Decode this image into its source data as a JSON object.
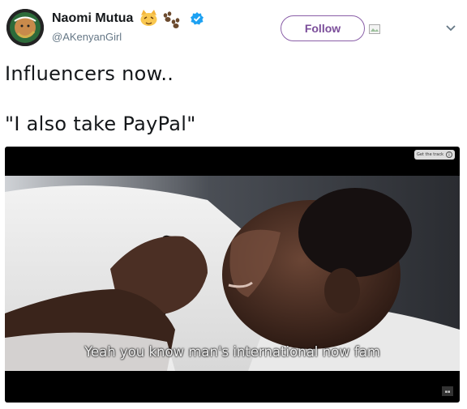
{
  "user": {
    "display_name": "Naomi Mutua",
    "handle": "@AKenyanGirl",
    "verified": true,
    "name_emoji": [
      "cat-face",
      "paw-prints"
    ]
  },
  "actions": {
    "follow_label": "Follow"
  },
  "tweet": {
    "lines": [
      "Influencers now..",
      "\"I also take PayPal\""
    ]
  },
  "media": {
    "subtitle": "Yeah you know man's international now fam",
    "overlay_label": "Get the track"
  },
  "colors": {
    "verified": "#1da1f2",
    "follow_accent": "#7b4e9a",
    "handle_gray": "#657786"
  }
}
